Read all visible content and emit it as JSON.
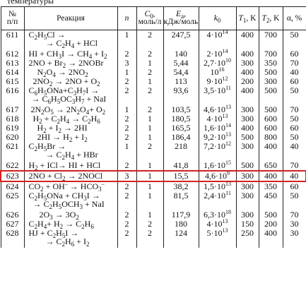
{
  "top_text": "температуры",
  "headers": {
    "no": "№ п/п",
    "reaction": "Реакция",
    "n": "n",
    "c0": "C0, моль/л",
    "ea": "Ea, кДж/моль",
    "k0": "k0",
    "t1": "T1, K",
    "t2": "T2, K",
    "alpha": "α, %"
  },
  "rows": [
    {
      "no": "611",
      "n": "1",
      "c0": "2",
      "ea": "247,5",
      "k0": "4·10^14",
      "t1": "400",
      "t2": "700",
      "a": "50"
    },
    {
      "no": "612",
      "n": "2",
      "c0": "2",
      "ea": "140",
      "k0": "2·10^14",
      "t1": "400",
      "t2": "700",
      "a": "60"
    },
    {
      "no": "613",
      "n": "3",
      "c0": "1",
      "ea": "5,44",
      "k0": "2,7·10^10",
      "t1": "300",
      "t2": "350",
      "a": "70"
    },
    {
      "no": "614",
      "n": "1",
      "c0": "2",
      "ea": "54,4",
      "k0": "10^16",
      "t1": "400",
      "t2": "500",
      "a": "40"
    },
    {
      "no": "615",
      "n": "2",
      "c0": "1",
      "ea": "113",
      "k0": "9·10^12",
      "t1": "200",
      "t2": "300",
      "a": "60"
    },
    {
      "no": "616",
      "n": "2",
      "c0": "2",
      "ea": "93,6",
      "k0": "3,5·10^11",
      "t1": "400",
      "t2": "500",
      "a": "50"
    },
    {
      "no": "617",
      "n": "1",
      "c0": "2",
      "ea": "103,5",
      "k0": "4,6·10^13",
      "t1": "300",
      "t2": "500",
      "a": "70"
    },
    {
      "no": "618",
      "n": "2",
      "c0": "1",
      "ea": "180,5",
      "k0": "4·10^13",
      "t1": "300",
      "t2": "600",
      "a": "50"
    },
    {
      "no": "619",
      "n": "2",
      "c0": "1",
      "ea": "165,5",
      "k0": "1,6·10^14",
      "t1": "400",
      "t2": "600",
      "a": "60"
    },
    {
      "no": "620",
      "n": "2",
      "c0": "1",
      "ea": "186,4",
      "k0": "9,2·10^13",
      "t1": "500",
      "t2": "800",
      "a": "50"
    },
    {
      "no": "621",
      "n": "1",
      "c0": "2",
      "ea": "218",
      "k0": "7,2·10^12",
      "t1": "300",
      "t2": "400",
      "a": "40"
    },
    {
      "no": "622",
      "n": "2",
      "c0": "1",
      "ea": "41,8",
      "k0": "1,6·10^15",
      "t1": "500",
      "t2": "650",
      "a": "70"
    },
    {
      "no": "623",
      "n": "3",
      "c0": "1",
      "ea": "15,5",
      "k0": "4,6·10^9",
      "t1": "300",
      "t2": "400",
      "a": "40"
    },
    {
      "no": "624",
      "n": "2",
      "c0": "1",
      "ea": "38,2",
      "k0": "1,5·10^13",
      "t1": "300",
      "t2": "350",
      "a": "60"
    },
    {
      "no": "625",
      "n": "2",
      "c0": "1",
      "ea": "81,5",
      "k0": "2,4·10^11",
      "t1": "300",
      "t2": "450",
      "a": "50"
    },
    {
      "no": "626",
      "n": "2",
      "c0": "1",
      "ea": "117,9",
      "k0": "6,3·10^18",
      "t1": "300",
      "t2": "500",
      "a": "70"
    },
    {
      "no": "627",
      "n": "2",
      "c0": "2",
      "ea": "180",
      "k0": "4·10^13",
      "t1": "150",
      "t2": "200",
      "a": "30"
    },
    {
      "no": "628",
      "n": "2",
      "c0": "2",
      "ea": "124",
      "k0": "5·10^13",
      "t1": "250",
      "t2": "400",
      "a": "30"
    }
  ],
  "highlight_row": "623",
  "highlight_color": "#d42020"
}
